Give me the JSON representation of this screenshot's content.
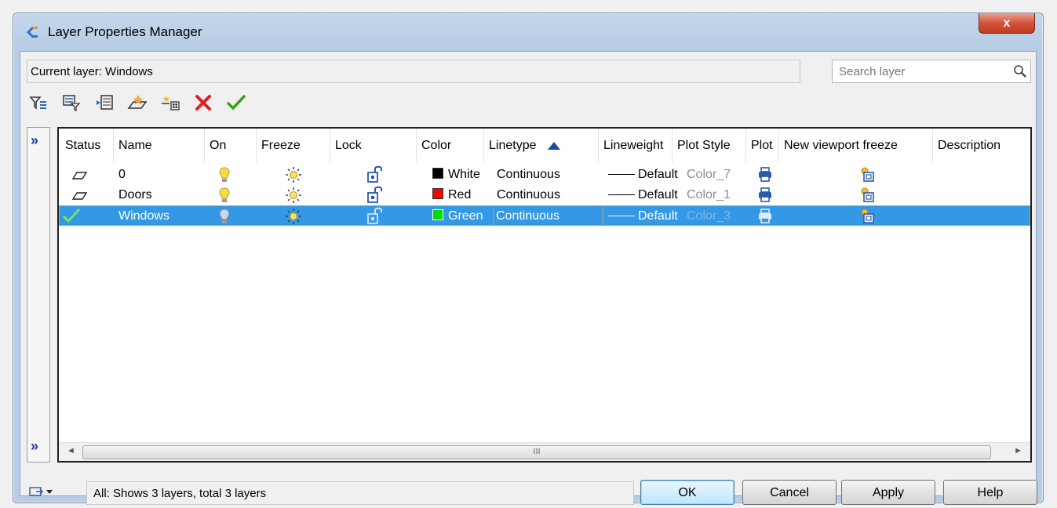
{
  "window": {
    "title": "Layer Properties Manager",
    "close_label": "x"
  },
  "current_layer": "Current layer: Windows",
  "search": {
    "placeholder": "Search layer"
  },
  "sidebar": {
    "expand_glyph": "»"
  },
  "columns": [
    "Status",
    "Name",
    "On",
    "Freeze",
    "Lock",
    "Color",
    "Linetype",
    "Lineweight",
    "Plot Style",
    "Plot",
    "New viewport freeze",
    "Description"
  ],
  "sorted_column": "Linetype",
  "layers": [
    {
      "name": "0",
      "color_name": "White",
      "color_hex": "#000000",
      "linetype": "Continuous",
      "lineweight": "Default",
      "plot_style": "Color_7",
      "current": false,
      "selected": false
    },
    {
      "name": "Doors",
      "color_name": "Red",
      "color_hex": "#ff0000",
      "linetype": "Continuous",
      "lineweight": "Default",
      "plot_style": "Color_1",
      "current": false,
      "selected": false
    },
    {
      "name": "Windows",
      "color_name": "Green",
      "color_hex": "#00dd00",
      "linetype": "Continuous",
      "lineweight": "Default",
      "plot_style": "Color_3",
      "current": true,
      "selected": true
    }
  ],
  "scrollbar": {
    "grip": "III",
    "left_arrow": "◄",
    "right_arrow": "►"
  },
  "status_text": "All: Shows 3 layers, total 3 layers",
  "buttons": {
    "ok": "OK",
    "cancel": "Cancel",
    "apply": "Apply",
    "help": "Help"
  },
  "colors": {
    "selection": "#3399e6",
    "selection_border": "#e89436",
    "title_bg": "#b8cde5"
  }
}
